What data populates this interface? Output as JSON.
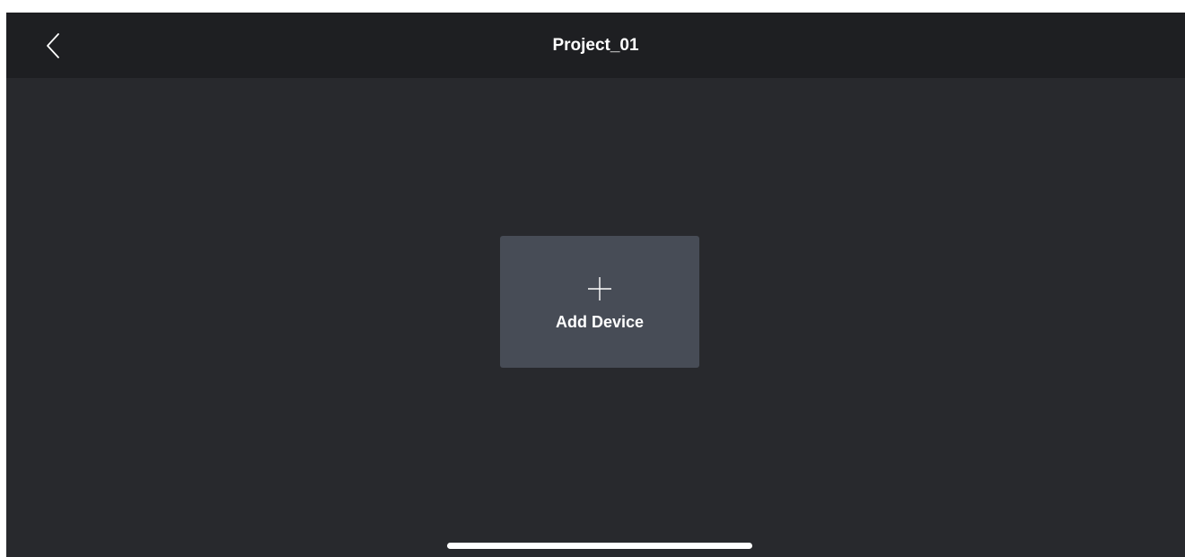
{
  "nav": {
    "title": "Project_01",
    "back_icon": "chevron-left-icon"
  },
  "main": {
    "add_device": {
      "icon": "plus-icon",
      "label": "Add Device"
    }
  },
  "colors": {
    "nav_background": "#1e1f22",
    "screen_background": "#28292d",
    "card_background": "#474c56",
    "text": "#ffffff"
  }
}
